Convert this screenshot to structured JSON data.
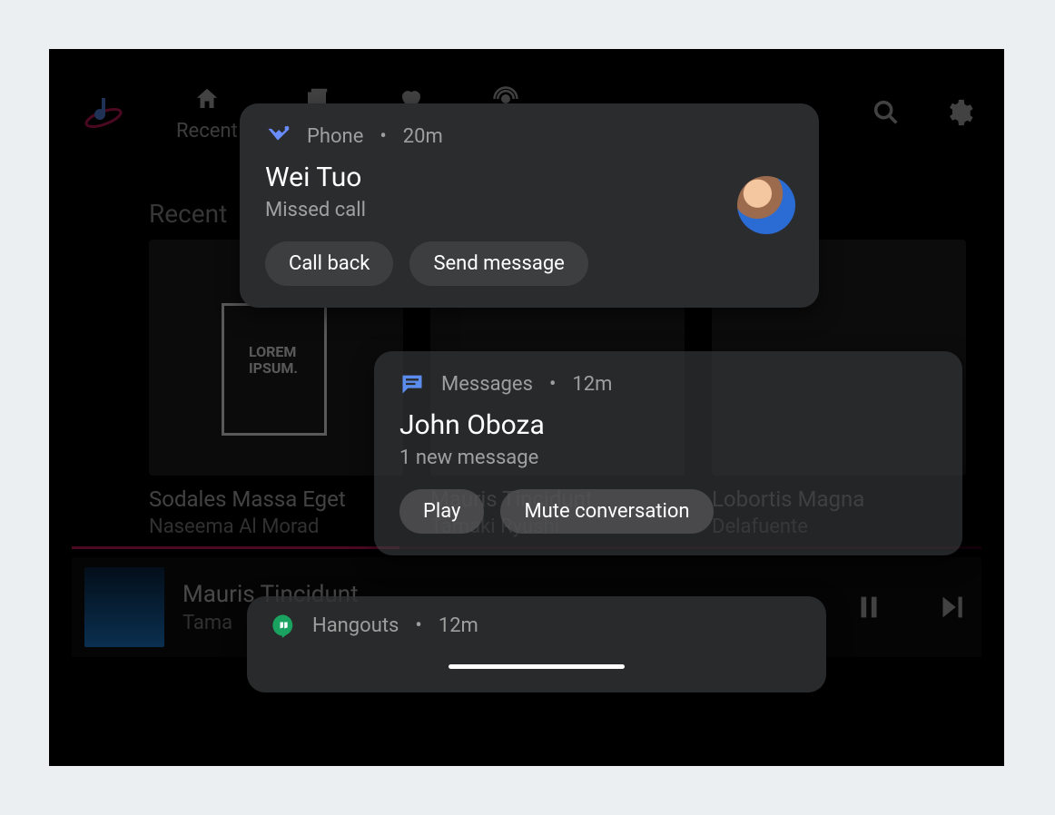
{
  "background": {
    "tabs": [
      "Recent"
    ],
    "section": "Recent",
    "cards": [
      {
        "title": "Sodales Massa Eget",
        "subtitle": "Naseema Al Morad",
        "art_label": "LOREM\nIPSUM."
      },
      {
        "title": "Mauris Tincidunt",
        "subtitle": "Tamaki Ryushi"
      },
      {
        "title": "Lobortis Magna",
        "subtitle": "Delafuente"
      }
    ],
    "now_playing": {
      "title": "Mauris Tincidunt",
      "subtitle": "Tama"
    }
  },
  "notifications": {
    "phone": {
      "app": "Phone",
      "time": "20m",
      "title": "Wei Tuo",
      "subtitle": "Missed call",
      "actions": [
        "Call back",
        "Send message"
      ]
    },
    "messages": {
      "app": "Messages",
      "time": "12m",
      "title": "John Oboza",
      "subtitle": "1 new message",
      "actions": [
        "Play",
        "Mute conversation"
      ]
    },
    "hangouts": {
      "app": "Hangouts",
      "time": "12m"
    }
  }
}
